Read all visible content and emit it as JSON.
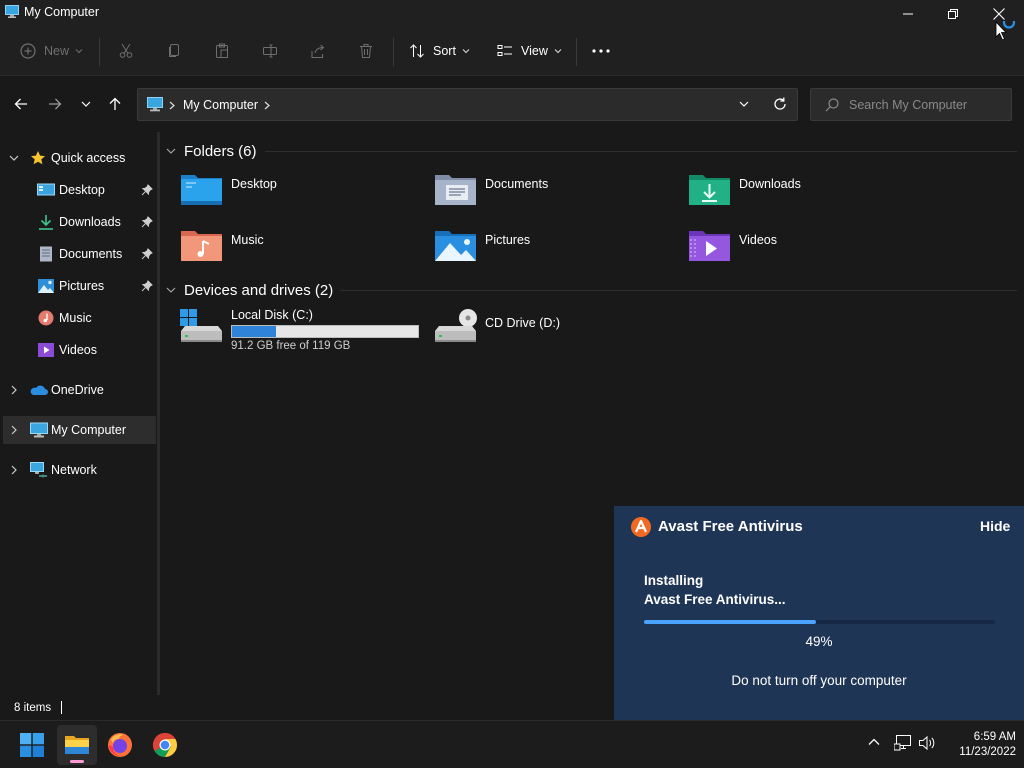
{
  "window": {
    "title": "My Computer",
    "controls": [
      "minimize",
      "restore",
      "close"
    ]
  },
  "commandbar": {
    "new_label": "New",
    "sort_label": "Sort",
    "view_label": "View",
    "more_label": "•••",
    "icons": [
      "cut-icon",
      "copy-icon",
      "paste-icon",
      "rename-icon",
      "share-icon",
      "delete-icon"
    ]
  },
  "address": {
    "crumbs": [
      "My Computer"
    ],
    "search_placeholder": "Search My Computer"
  },
  "sidebar": {
    "quick_access": "Quick access",
    "items": [
      {
        "label": "Desktop",
        "icon": "desktop-icon",
        "pinned": true
      },
      {
        "label": "Downloads",
        "icon": "downloads-icon",
        "pinned": true
      },
      {
        "label": "Documents",
        "icon": "documents-icon",
        "pinned": true
      },
      {
        "label": "Pictures",
        "icon": "pictures-icon",
        "pinned": true
      },
      {
        "label": "Music",
        "icon": "music-icon",
        "pinned": false
      },
      {
        "label": "Videos",
        "icon": "videos-icon",
        "pinned": false
      }
    ],
    "onedrive": "OneDrive",
    "mycomputer": "My Computer",
    "network": "Network",
    "selected": "My Computer"
  },
  "content": {
    "folders_header": "Folders (6)",
    "folders": [
      {
        "name": "Desktop",
        "icon": "desktop-folder-icon"
      },
      {
        "name": "Documents",
        "icon": "documents-folder-icon"
      },
      {
        "name": "Downloads",
        "icon": "downloads-folder-icon"
      },
      {
        "name": "Music",
        "icon": "music-folder-icon"
      },
      {
        "name": "Pictures",
        "icon": "pictures-folder-icon"
      },
      {
        "name": "Videos",
        "icon": "videos-folder-icon"
      }
    ],
    "drives_header": "Devices and drives (2)",
    "drives": [
      {
        "name": "Local Disk (C:)",
        "free_text": "91.2 GB free of 119 GB",
        "used_fraction": 0.234
      },
      {
        "name": "CD Drive (D:)"
      }
    ]
  },
  "status": {
    "item_count": "8 items"
  },
  "taskbar": {
    "apps": [
      "start-icon",
      "file-explorer-icon",
      "firefox-icon",
      "chrome-icon"
    ],
    "active_app": "file-explorer-icon",
    "time": "6:59 AM",
    "date": "11/23/2022"
  },
  "avast": {
    "title": "Avast Free Antivirus",
    "hide_label": "Hide",
    "status_line1": "Installing",
    "status_line2": "Avast Free Antivirus...",
    "progress_percent": 49,
    "progress_text": "49%",
    "note": "Do not turn off your computer",
    "brand_color": "#f26a22",
    "background_color": "#1f3556"
  },
  "colors": {
    "accent": "#2f83d8",
    "window_bg": "#191919",
    "chrome_bg": "#202020"
  }
}
